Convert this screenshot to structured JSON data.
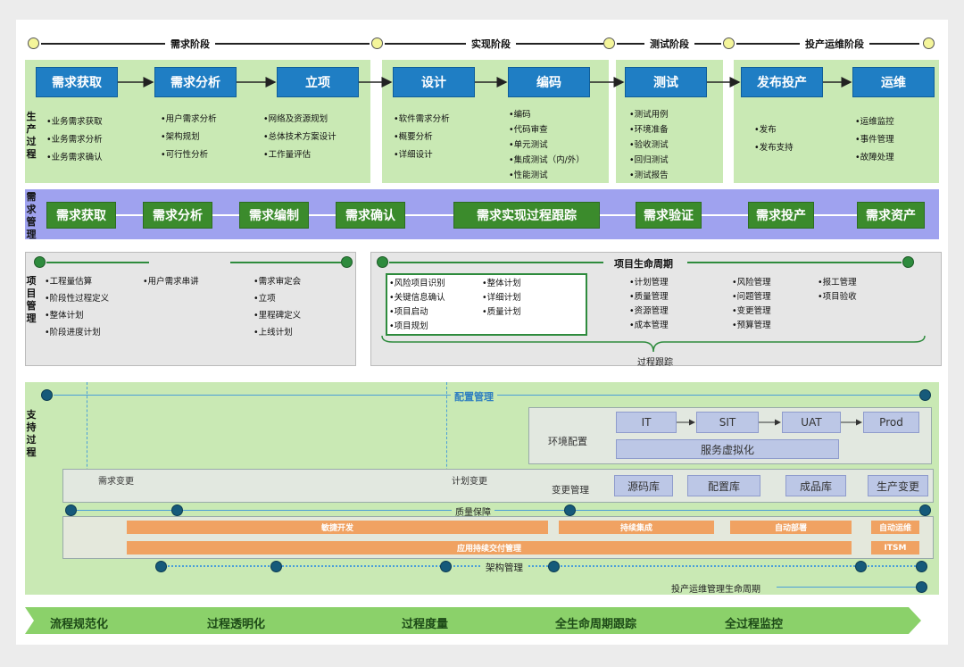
{
  "phases": {
    "p1": "需求阶段",
    "p2": "实现阶段",
    "p3": "测试阶段",
    "p4": "投产运维阶段"
  },
  "production": {
    "side_label": "生产过程",
    "steps": [
      "需求获取",
      "需求分析",
      "立项",
      "设计",
      "编码",
      "测试",
      "发布投产",
      "运维"
    ],
    "lists": {
      "c1": [
        "•业务需求获取",
        "•业务需求分析",
        "•业务需求确认"
      ],
      "c2": [
        "•用户需求分析",
        "•架构规划",
        "•可行性分析"
      ],
      "c3": [
        "•网络及资源规划",
        "•总体技术方案设计",
        "•工作量评估"
      ],
      "c4": [
        "•软件需求分析",
        "•概要分析",
        "•详细设计"
      ],
      "c5": [
        "•编码",
        "•代码审查",
        "•单元测试",
        "•集成测试（内/外）",
        "•性能测试"
      ],
      "c6": [
        "•测试用例",
        "•环境准备",
        "•验收测试",
        "•回归测试",
        "•测试报告"
      ],
      "c7": [
        "•发布",
        "•发布支持"
      ],
      "c8": [
        "•运维监控",
        "•事件管理",
        "•故障处理"
      ]
    }
  },
  "req_mgmt": {
    "side_label": "需求管理",
    "steps": [
      "需求获取",
      "需求分析",
      "需求编制",
      "需求确认",
      "需求实现过程跟踪",
      "需求验证",
      "需求投产",
      "需求资产"
    ]
  },
  "project": {
    "side_label": "项目管理",
    "left_col1": [
      "•工程量估算",
      "•阶段性过程定义",
      "•整体计划",
      "•阶段进度计划"
    ],
    "left_col2": [
      "•用户需求串讲"
    ],
    "left_col3": [
      "•需求审定会",
      "•立项",
      "•里程碑定义",
      "•上线计划"
    ],
    "lifecycle_title": "项目生命周期",
    "box_col1": [
      "•风险项目识别",
      "•关键信息确认",
      "•项目启动",
      "•项目规划"
    ],
    "box_col2": [
      "•整体计划",
      "•详细计划",
      "•质量计划"
    ],
    "col3": [
      "•计划管理",
      "•质量管理",
      "•资源管理",
      "•成本管理"
    ],
    "col4": [
      "•风险管理",
      "•问题管理",
      "•变更管理",
      "•预算管理"
    ],
    "col5": [
      "•报工管理",
      "•项目验收"
    ],
    "tracking": "过程跟踪"
  },
  "support": {
    "side_label": "支持过程",
    "config_mgmt": "配置管理",
    "env_label": "环境配置",
    "envs": [
      "IT",
      "SIT",
      "UAT",
      "Prod"
    ],
    "virtualization": "服务虚拟化",
    "req_change": "需求变更",
    "plan_change": "计划变更",
    "change_mgmt": "变更管理",
    "change_steps": [
      "源码库",
      "配置库",
      "成品库",
      "生产变更"
    ],
    "quality": "质量保障",
    "orange1": [
      "敏捷开发",
      "持续集成",
      "自动部署",
      "自动运维"
    ],
    "orange2": [
      "应用持续交付管理",
      "ITSM"
    ],
    "arch": "架构管理",
    "ops_lifecycle": "投产运维管理生命周期"
  },
  "bottom": [
    "流程规范化",
    "过程透明化",
    "过程度量",
    "全生命周期跟踪",
    "全过程监控"
  ]
}
